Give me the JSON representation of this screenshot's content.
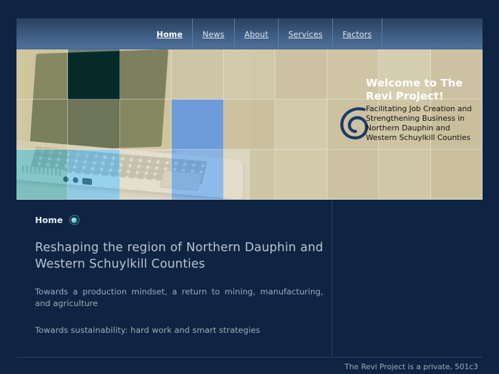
{
  "site": {
    "name": "The Revi Project",
    "background_color": "#0f2442",
    "accent_color": "#4d6f98",
    "tile_beige": "#cfc6a5",
    "tile_blue": "#6c9bd8",
    "logo_color": "#1d3a6b"
  },
  "nav": {
    "items": [
      {
        "label": "Home",
        "active": true
      },
      {
        "label": "News",
        "active": false
      },
      {
        "label": "About",
        "active": false
      },
      {
        "label": "Services",
        "active": false
      },
      {
        "label": "Factors",
        "active": false
      }
    ]
  },
  "hero": {
    "image_alt": "laptop-photo",
    "logo_icon": "spiral-logo-icon",
    "welcome_title": "Welcome to The Revi Project!",
    "welcome_subtitle": "Facilitating Job Creation and Strengthening Business in Northern Dauphin and Western Schuylkill Counties"
  },
  "main": {
    "breadcrumb": "Home",
    "breadcrumb_icon": "bullet-circle-icon",
    "headline": "Reshaping the region of Northern Dauphin and Western Schuylkill Counties",
    "paragraphs": [
      "Towards a production mindset, a return to mining, manufacturing, and agriculture",
      "Towards sustainability: hard work and smart strategies"
    ]
  },
  "sidebar": {
    "footer_text": "The Revi Project is a private, 501c3"
  }
}
